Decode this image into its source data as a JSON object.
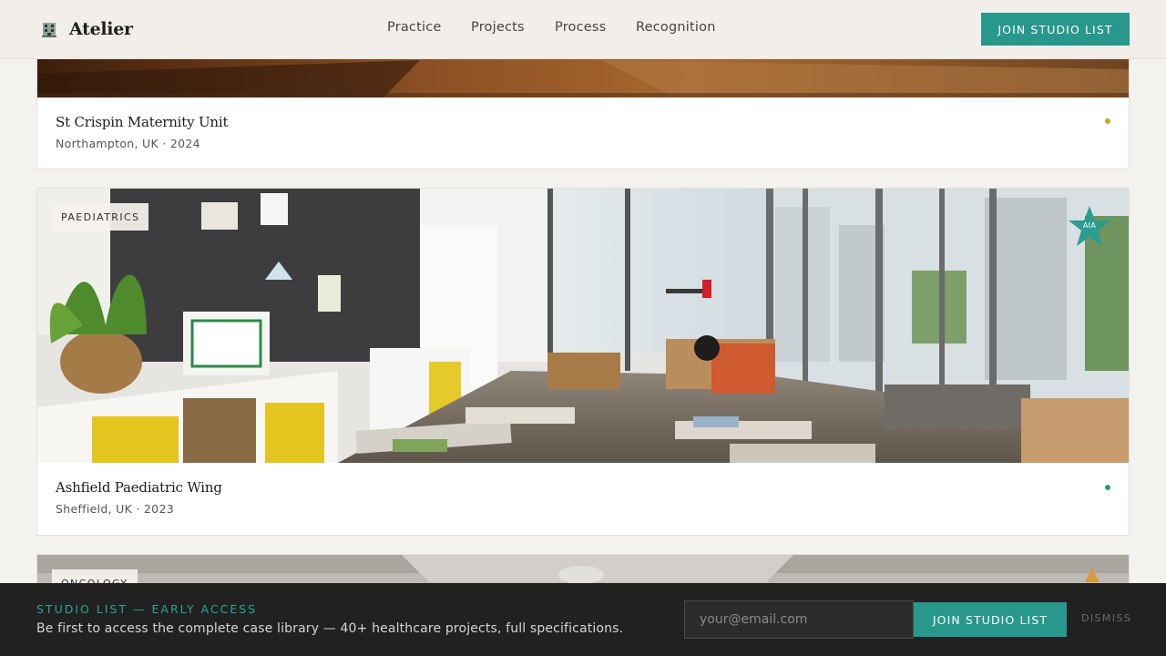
{
  "header": {
    "brand_name": "Atelier",
    "brand_icon": "building-icon",
    "nav": [
      {
        "label": "Practice"
      },
      {
        "label": "Projects"
      },
      {
        "label": "Process"
      },
      {
        "label": "Recognition"
      }
    ],
    "cta_label": "JOIN STUDIO LIST"
  },
  "projects": [
    {
      "title": "St Crispin Maternity Unit",
      "meta": "Northampton, UK · 2024",
      "status_color": "#c9a227"
    },
    {
      "tag": "PAEDIATRICS",
      "award": "AIA",
      "award_icon": "star-icon",
      "title": "Ashfield Paediatric Wing",
      "meta": "Sheffield, UK · 2023",
      "status_color": "#27988b"
    },
    {
      "tag": "ONCOLOGY"
    }
  ],
  "banner": {
    "kicker": "STUDIO LIST — EARLY ACCESS",
    "text": "Be first to access the complete case library — 40+ healthcare projects, full specifications.",
    "email_placeholder": "your@email.com",
    "cta_label": "JOIN STUDIO LIST",
    "dismiss_label": "DISMISS"
  },
  "colors": {
    "accent": "#27988b",
    "banner_bg": "#212121",
    "header_bg": "#f2efeb"
  }
}
